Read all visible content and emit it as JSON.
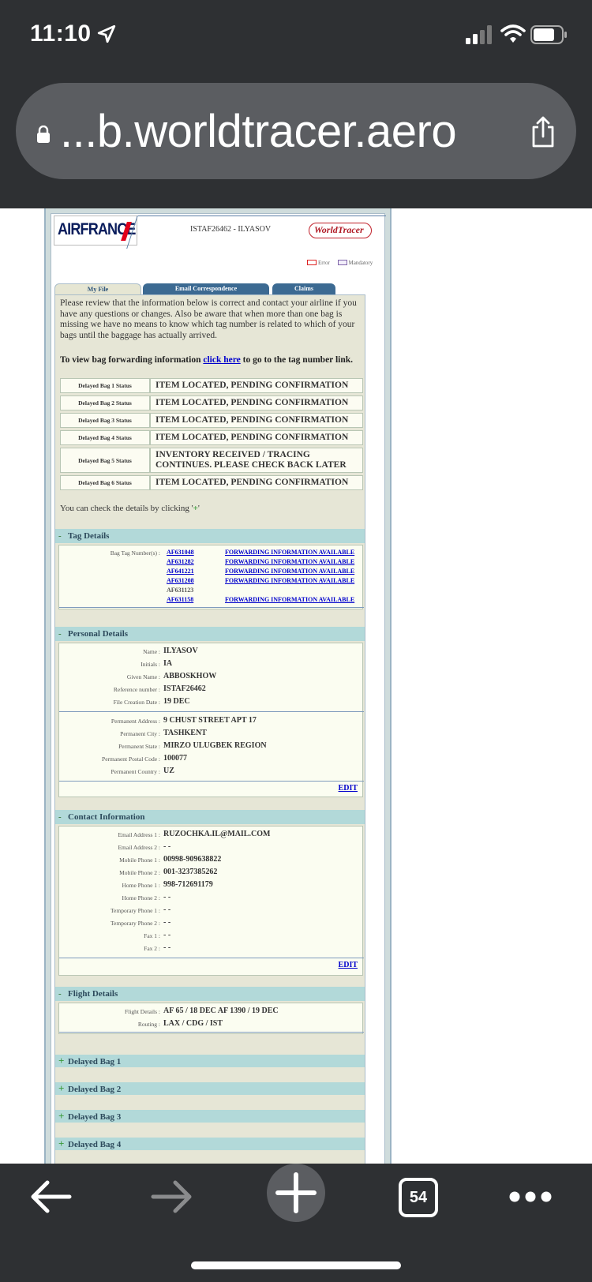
{
  "status_bar": {
    "time": "11:10"
  },
  "browser": {
    "url": "...b.worldtracer.aero",
    "tab_count": "54"
  },
  "header": {
    "logo_text": "AIRFRANCE",
    "file_ref": "ISTAF26462  -  ILYASOV",
    "worldtracer_logo": "WorldTracer"
  },
  "legend": {
    "error": "Error",
    "mandatory": "Mandatory"
  },
  "tabs": [
    {
      "label": "My File"
    },
    {
      "label": "Email Correspondence"
    },
    {
      "label": "Claims"
    }
  ],
  "intro": "Please review that the information below is correct and contact your airline if you have any questions or changes. Also be aware that when more than one bag is missing we have no means to know which tag number is related to which of your bags until the baggage has actually arrived.",
  "forwarding": {
    "before": "To view bag forwarding information ",
    "link": "click here",
    "after": " to go to the tag number link."
  },
  "bag_statuses": [
    {
      "label": "Delayed Bag 1 Status",
      "value": "ITEM LOCATED, PENDING CONFIRMATION"
    },
    {
      "label": "Delayed Bag 2 Status",
      "value": "ITEM LOCATED, PENDING CONFIRMATION"
    },
    {
      "label": "Delayed Bag 3 Status",
      "value": "ITEM LOCATED, PENDING CONFIRMATION"
    },
    {
      "label": "Delayed Bag 4 Status",
      "value": "ITEM LOCATED, PENDING CONFIRMATION"
    },
    {
      "label": "Delayed Bag 5 Status",
      "value": "INVENTORY RECEIVED / TRACING CONTINUES. PLEASE CHECK BACK LATER"
    },
    {
      "label": "Delayed Bag 6 Status",
      "value": "ITEM LOCATED, PENDING CONFIRMATION"
    }
  ],
  "check_note": {
    "text": "You can check the details by clicking '",
    "plus": "+",
    "end": "'"
  },
  "tag_details": {
    "title": "Tag Details",
    "toggle": "-",
    "label": "Bag Tag Number(s) :",
    "tags": [
      {
        "tag": "AF631048",
        "forward": "FORWARDING INFORMATION AVAILABLE"
      },
      {
        "tag": "AF631282",
        "forward": "FORWARDING INFORMATION AVAILABLE"
      },
      {
        "tag": "AF641221",
        "forward": "FORWARDING INFORMATION AVAILABLE"
      },
      {
        "tag": "AF631208",
        "forward": "FORWARDING INFORMATION AVAILABLE"
      },
      {
        "tag": "AF631123",
        "forward": ""
      },
      {
        "tag": "AF631158",
        "forward": "FORWARDING INFORMATION AVAILABLE"
      }
    ]
  },
  "personal": {
    "title": "Personal Details",
    "toggle": "-",
    "rows_a": [
      {
        "label": "Name :",
        "value": "ILYASOV"
      },
      {
        "label": "Initials :",
        "value": "IA"
      },
      {
        "label": "Given Name :",
        "value": "ABBOSKHOW"
      },
      {
        "label": "Reference number :",
        "value": "ISTAF26462"
      },
      {
        "label": "File Creation Date :",
        "value": "19 DEC"
      }
    ],
    "rows_b": [
      {
        "label": "Permanent Address :",
        "value": "9 CHUST STREET APT 17"
      },
      {
        "label": "Permanent City :",
        "value": "TASHKENT"
      },
      {
        "label": "Permanent State :",
        "value": "MIRZO ULUGBEK REGION"
      },
      {
        "label": "Permanent Postal Code :",
        "value": "100077"
      },
      {
        "label": "Permanent Country :",
        "value": "UZ"
      }
    ],
    "edit": "EDIT"
  },
  "contact": {
    "title": "Contact Information",
    "toggle": "-",
    "rows": [
      {
        "label": "Email Address 1 :",
        "value": "RUZOCHKA.IL@MAIL.COM"
      },
      {
        "label": "Email Address 2 :",
        "value": "- -"
      },
      {
        "label": "Mobile Phone 1 :",
        "value": "00998-909638822"
      },
      {
        "label": "Mobile Phone 2 :",
        "value": "001-3237385262"
      },
      {
        "label": "Home Phone 1 :",
        "value": "998-712691179"
      },
      {
        "label": "Home Phone 2 :",
        "value": "- -"
      },
      {
        "label": "Temporary Phone 1 :",
        "value": "- -"
      },
      {
        "label": "Temporary Phone 2 :",
        "value": "- -"
      },
      {
        "label": "Fax 1 :",
        "value": "- -"
      },
      {
        "label": "Fax 2 :",
        "value": "- -"
      }
    ],
    "edit": "EDIT"
  },
  "flight": {
    "title": "Flight Details",
    "toggle": "-",
    "rows": [
      {
        "label": "Flight Details :",
        "value": "AF 65 / 18 DEC    AF 1390 / 19 DEC"
      },
      {
        "label": "Routing :",
        "value": "LAX  / CDG  / IST"
      }
    ]
  },
  "delayed_bags": [
    {
      "toggle": "+",
      "label": "Delayed Bag 1"
    },
    {
      "toggle": "+",
      "label": "Delayed Bag 2"
    },
    {
      "toggle": "+",
      "label": "Delayed Bag 3"
    },
    {
      "toggle": "+",
      "label": "Delayed Bag 4"
    }
  ],
  "colors": {
    "chrome": "#2e3033",
    "section_header": "#b2d9d9",
    "link": "#0000cc",
    "af_red": "#e2001a"
  },
  "icons": {
    "status": [
      "location-arrow-icon",
      "cellular-signal-icon",
      "wifi-icon",
      "battery-icon"
    ],
    "browser": [
      "lock-icon",
      "share-icon",
      "back-arrow-icon",
      "forward-arrow-icon",
      "plus-icon",
      "more-icon"
    ]
  }
}
